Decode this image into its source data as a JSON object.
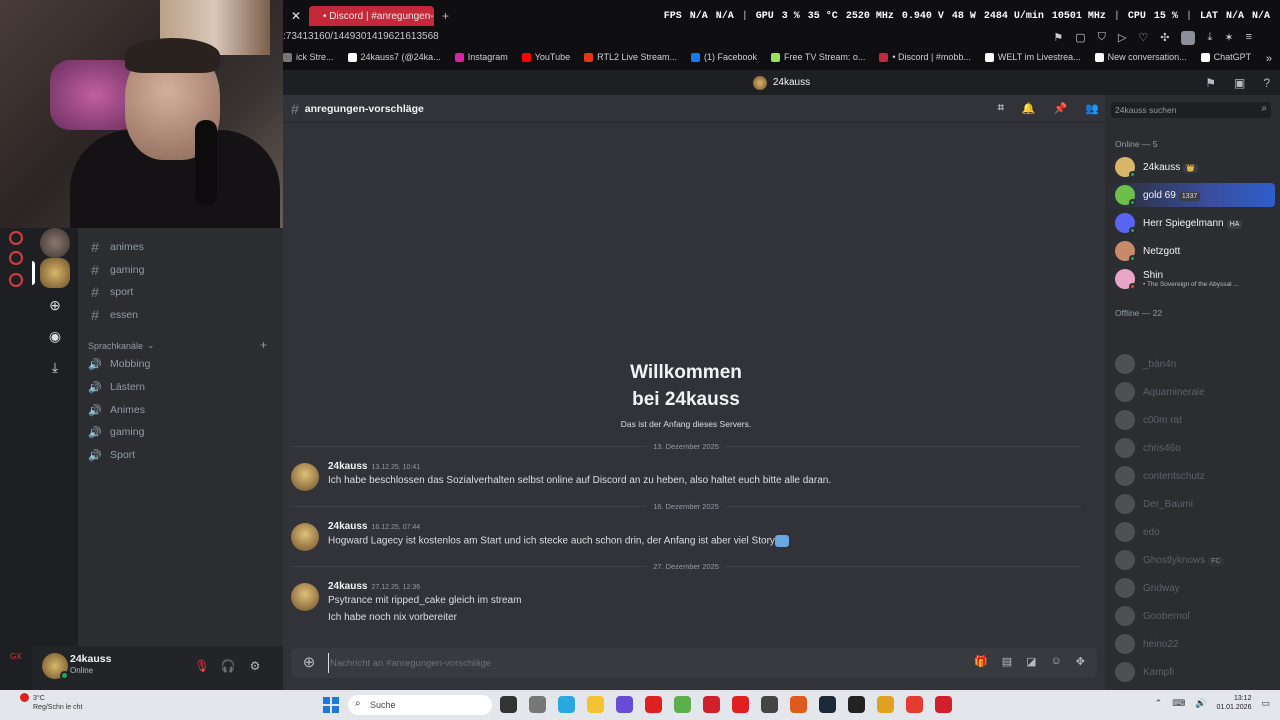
{
  "browser": {
    "tab_title": "• Discord | #anregungen-",
    "url": ":73413160/1449301419621613568",
    "bookmarks": [
      "ick Stre...",
      "24kauss7 (@24ka...",
      "Instagram",
      "YouTube",
      "RTL2 Live Stream...",
      "(1) Facebook",
      "Free TV Stream: o...",
      "• Discord | #mobb...",
      "WELT im Livestrea...",
      "New conversation...",
      "ChatGPT"
    ],
    "bookmark_colors": [
      "#777777",
      "#ffffff",
      "#d6249f",
      "#ff0000",
      "#e63312",
      "#1877f2",
      "#9be15d",
      "#c4283a",
      "#ffffff",
      "#ffffff",
      "#ffffff"
    ]
  },
  "osd": {
    "fps_label": "FPS",
    "fps1": "N/A",
    "fps2": "N/A",
    "gpu_label": "GPU",
    "gpu_load": "3 %",
    "gpu_temp": "35 °C",
    "gpu_clock": "2520 MHz",
    "gpu_volt": "0.940 V",
    "gpu_power": "48 W",
    "gpu_fan": "2484 U/min",
    "gpu_mem": "10501 MHz",
    "cpu_label": "CPU",
    "cpu_load": "15 %",
    "lat_label": "LAT",
    "lat1": "N/A",
    "lat2": "N/A"
  },
  "discord": {
    "window_title": "24kauss",
    "channel_name": "anregungen-vorschläge",
    "text_channels": [
      "animes",
      "gaming",
      "sport",
      "essen"
    ],
    "voice_category": "Sprachkanäle",
    "voice_channels": [
      "Mobbing",
      "Lästern",
      "Animes",
      "gaming",
      "Sport"
    ],
    "welcome_title": "Willkommen bei 24kauss",
    "welcome_sub": "Das ist der Anfang dieses Servers.",
    "dividers": [
      "13. Dezember 2025",
      "16. Dezember 2025",
      "27. Dezember 2025"
    ],
    "messages": [
      {
        "author": "24kauss",
        "time": "13.12.25, 10:41",
        "text": "Ich habe beschlossen das Sozialverhalten selbst online auf Discord an zu heben, also haltet euch bitte alle daran.",
        "text2": ""
      },
      {
        "author": "24kauss",
        "time": "16.12.25, 07:44",
        "text": "Hogward Lagecy ist kostenlos am Start und ich stecke auch schon drin, der Anfang ist aber viel Story",
        "text2": ""
      },
      {
        "author": "24kauss",
        "time": "27.12.25, 12:36",
        "text": "Psytrance mit ripped_cake gleich im stream",
        "text2": "Ich habe noch nix vorbereiter"
      }
    ],
    "composer_placeholder": "Nachricht an #anregungen-vorschläge",
    "member_search_placeholder": "24kauss suchen",
    "online_header": "Online — 5",
    "online_members": [
      {
        "name": "24kauss",
        "badge": "👑",
        "sub": "",
        "color": "#d8b66a"
      },
      {
        "name": "gold 69",
        "badge": "1337",
        "sub": "",
        "color": "#6cc04a"
      },
      {
        "name": "Herr Spiegelmann",
        "badge": "HA",
        "sub": "",
        "color": "#5865f2"
      },
      {
        "name": "Netzgott",
        "badge": "",
        "sub": "",
        "color": "#c98a6a"
      },
      {
        "name": "Shin",
        "badge": "",
        "sub": "• The Sovereign of the Abyssal ...",
        "color": "#e7a6c8"
      }
    ],
    "offline_header": "Offline — 22",
    "offline_members": [
      "_bán4n",
      "Aquamineraie",
      "c00m rat",
      "chris46o",
      "contentschutz",
      "Der_Baumi",
      "edo",
      "Ghostlyknows",
      "Gndway",
      "Goobernol",
      "heino22",
      "Kampfi",
      "Kevin L"
    ],
    "offline_badge_ghost": "FC",
    "user": {
      "name": "24kauss",
      "status": "Online"
    }
  },
  "taskbar": {
    "weather_temp": "3°C",
    "weather_desc": "Reg/Schn le cht",
    "search_label": "Suche",
    "time": "13:12",
    "date": "01.01.2026",
    "app_colors": [
      "#333333",
      "#777777",
      "#2aa7e0",
      "#f4c430",
      "#6a4bd6",
      "#e02020",
      "#5bb04a",
      "#d0202c",
      "#e02020",
      "#444444",
      "#e05a1c",
      "#1b2838",
      "#222222",
      "#e0a020",
      "#e43d30",
      "#d0202c"
    ]
  },
  "colors": {
    "accent": "#5865f2",
    "online": "#23a55a",
    "danger": "#f23f42",
    "tab": "#c4283a"
  }
}
